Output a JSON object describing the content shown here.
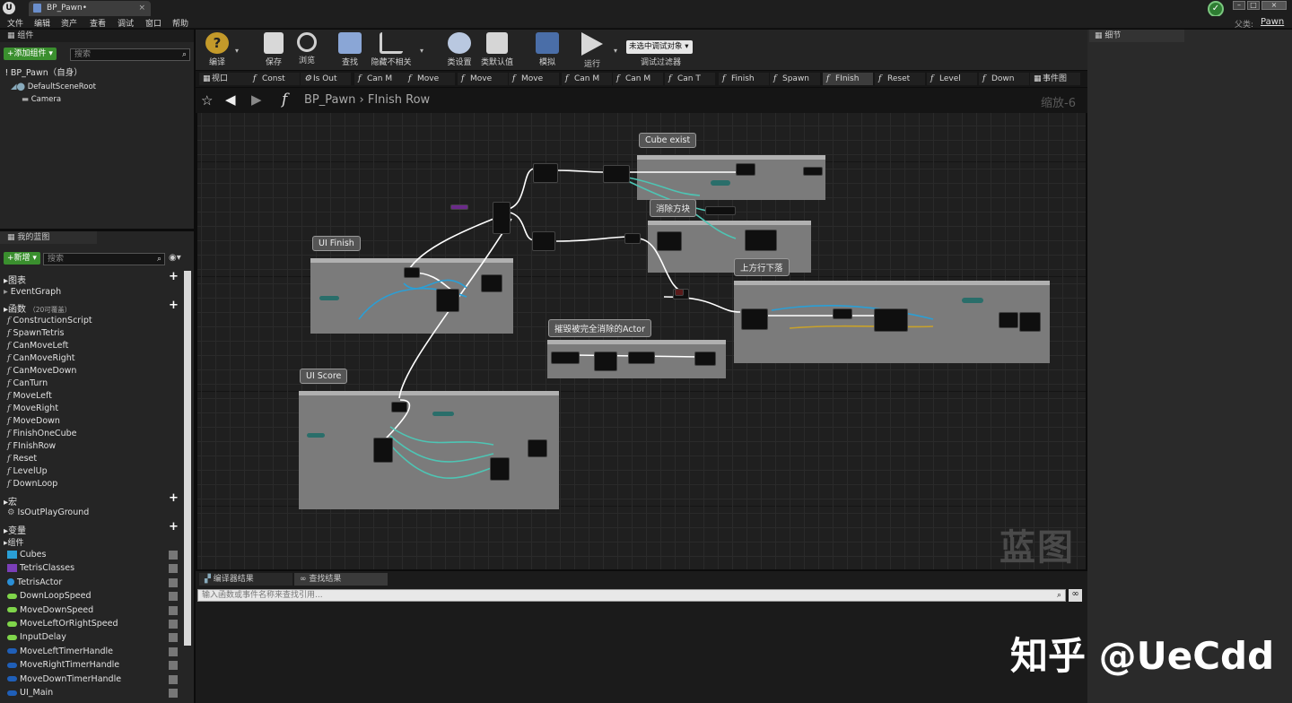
{
  "window": {
    "doc_tab": "BP_Pawn•",
    "parent_label": "父类:",
    "parent_value": "Pawn"
  },
  "menu": [
    "文件",
    "编辑",
    "资产",
    "查看",
    "调试",
    "窗口",
    "帮助"
  ],
  "components_panel": {
    "title": "组件",
    "add_button": "+添加组件 ▾",
    "search_placeholder": "搜索",
    "self_item": "BP_Pawn（自身）",
    "tree": [
      "DefaultSceneRoot",
      "Camera"
    ]
  },
  "my_blueprint": {
    "tab": "我的蓝图",
    "new_button": "+新增 ▾",
    "search_placeholder": "搜索",
    "graphs_header": "图表",
    "graphs": [
      "EventGraph"
    ],
    "functions_header": "函数",
    "functions_note": "（20可覆盖）",
    "functions": [
      "ConstructionScript",
      "SpawnTetris",
      "CanMoveLeft",
      "CanMoveRight",
      "CanMoveDown",
      "CanTurn",
      "MoveLeft",
      "MoveRight",
      "MoveDown",
      "FinishOneCube",
      "FInishRow",
      "Reset",
      "LevelUp",
      "DownLoop"
    ],
    "macros_header": "宏",
    "macros": [
      "IsOutPlayGround"
    ],
    "variables_header": "变量",
    "var_group": "组件",
    "variables": [
      {
        "name": "Cubes",
        "color": "#2a9fd6",
        "shape": "grid"
      },
      {
        "name": "TetrisClasses",
        "color": "#7b3fb8",
        "shape": "square"
      },
      {
        "name": "TetrisActor",
        "color": "#2a8fd6",
        "shape": "ball"
      },
      {
        "name": "DownLoopSpeed",
        "color": "#7fd54a",
        "shape": "pill"
      },
      {
        "name": "MoveDownSpeed",
        "color": "#7fd54a",
        "shape": "pill"
      },
      {
        "name": "MoveLeftOrRightSpeed",
        "color": "#7fd54a",
        "shape": "pill"
      },
      {
        "name": "InputDelay",
        "color": "#7fd54a",
        "shape": "pill"
      },
      {
        "name": "MoveLeftTimerHandle",
        "color": "#1f5fb8",
        "shape": "pill"
      },
      {
        "name": "MoveRightTimerHandle",
        "color": "#1f5fb8",
        "shape": "pill"
      },
      {
        "name": "MoveDownTimerHandle",
        "color": "#1f5fb8",
        "shape": "pill"
      },
      {
        "name": "UI_Main",
        "color": "#1f5fb8",
        "shape": "pill"
      }
    ]
  },
  "toolbar": {
    "compile": "编译",
    "save": "保存",
    "browse": "浏览",
    "find": "查找",
    "hide_unrelated": "隐藏不相关",
    "class_settings": "类设置",
    "class_defaults": "类默认值",
    "simulate": "模拟",
    "play": "运行",
    "debug_select": "未选中调试对象 ▾",
    "debug_filter": "调试过滤器"
  },
  "graph_tabs": [
    "视口",
    "Const",
    "Is Out",
    "Can M",
    "Move",
    "Move",
    "Move",
    "Can M",
    "Can M",
    "Can T",
    "Finish",
    "Spawn",
    "FInish",
    "Reset",
    "Level",
    "Down",
    "事件图"
  ],
  "breadcrumb": {
    "bp": "BP_Pawn",
    "sep": "›",
    "fn": "FInish Row"
  },
  "zoom": "缩放-6",
  "comments": [
    "Cube exist",
    "消除方块",
    "UI Finish",
    "上方行下落",
    "摧毁被完全消除的Actor",
    "UI Score"
  ],
  "graph_watermark": "蓝图",
  "details_tab": "细节",
  "bottom": {
    "compiler_tab": "编译器结果",
    "find_tab": "查找结果",
    "find_placeholder": "输入函数或事件名称来查找引用..."
  },
  "overlay_watermark": "知乎 @UeCdd"
}
